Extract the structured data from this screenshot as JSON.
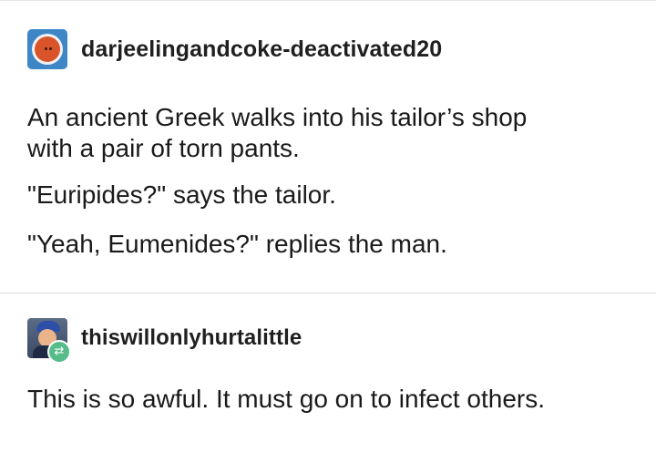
{
  "post_original": {
    "username": "darjeelingandcoke-deactivated20",
    "avatar_icon": "orange-circle-face-icon",
    "paragraphs": [
      "An ancient Greek walks into his tailor’s shop",
      "with a pair of torn pants.",
      "\"Euripides?\" says the tailor.",
      "\"Yeah, Eumenides?\" replies the man."
    ]
  },
  "post_reblog": {
    "username": "thiswillonlyhurtalittle",
    "avatar_icon": "user-avatar-icon",
    "badge_icon": "reblog-icon",
    "badge_glyph": "⇄",
    "text": "This is so awful. It must go on to infect others."
  },
  "colors": {
    "avatar_blue": "#3f86c6",
    "avatar_face": "#d9542b",
    "reblog_green": "#56bc8a",
    "text": "#1a1a1a"
  }
}
